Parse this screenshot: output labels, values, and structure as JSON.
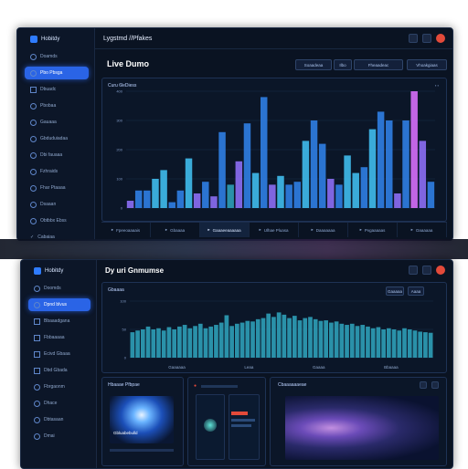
{
  "window1": {
    "app_name": "Hobitdy",
    "topbar_title": "Lygstmd //Pfakes",
    "page_title": "Live Dumo",
    "buttons": [
      "Soaadeaa",
      "Ilbo",
      "Fheaadeac",
      "Vhoakgiaas"
    ],
    "nav": [
      {
        "label": "Doamds",
        "icon": "dot"
      },
      {
        "label": "Pbo Pbsga",
        "icon": "dot"
      },
      {
        "label": "Dbuadc",
        "icon": "sq"
      },
      {
        "label": "Pbobaa",
        "icon": "dot"
      },
      {
        "label": "Gauaaa",
        "icon": "dot"
      },
      {
        "label": "Gbduduiadaa",
        "icon": "dot"
      },
      {
        "label": "Dbi fauaaa",
        "icon": "dot"
      },
      {
        "label": "Fzhraids",
        "icon": "dot"
      },
      {
        "label": "Fhar Ptaaaa",
        "icon": "dot"
      },
      {
        "label": "Dsaaan",
        "icon": "dot"
      },
      {
        "label": "Obtbbx Ebss",
        "icon": "dot"
      },
      {
        "label": "Cabaiaa",
        "icon": "check"
      }
    ],
    "active_nav": 1,
    "chart_panel_title": "Curu 6leDiess",
    "tabs": [
      "Fpeeoaaaais",
      "Gbaaaa",
      "Gaaaeeaaaaaa",
      "Ulhae Pluasa",
      "Daaaaaaa",
      "Pvgaaaaas",
      "Oaaaaaa"
    ],
    "active_tab": 2
  },
  "window2": {
    "app_name": "Hobitdy",
    "page_title": "Dy uri Gnmumse",
    "nav": [
      {
        "label": "Doomds",
        "icon": "dot"
      },
      {
        "label": "Dpnd blvus",
        "icon": "dot"
      },
      {
        "label": "Bbaaadgana",
        "icon": "sq"
      },
      {
        "label": "Fbbaaaaa",
        "icon": "sq"
      },
      {
        "label": "Ecivd Gbaaa",
        "icon": "sq"
      },
      {
        "label": "Dbd Gbada",
        "icon": "sq"
      },
      {
        "label": "Fbrgaonm",
        "icon": "dot"
      },
      {
        "label": "Dhace",
        "icon": "dot"
      },
      {
        "label": "Dbtasaan",
        "icon": "dot"
      },
      {
        "label": "Dmai",
        "icon": "dot"
      }
    ],
    "active_nav": 1,
    "chart_panel_title": "Gbaaaa",
    "chart_buttons": [
      "Gaaaaa",
      "Aaaa"
    ],
    "chart_footer": [
      "Gaaaaaa",
      "Leaa",
      "Gaaaa",
      "Bbaaaa"
    ],
    "card1_title": "Hbaaae Pfbpae",
    "card1_caption": "Gbluabebulld",
    "card3_title": "Cbaaaaaaeae"
  },
  "colors": {
    "accent": "#2a64e6",
    "bar_blue": "#2f7de0",
    "bar_cyan": "#3fb8e8",
    "bar_violet": "#8a6cf0",
    "bar_pink": "#d26cf5",
    "bar_teal": "#2e9cb4",
    "close": "#e34a3a"
  },
  "chart_data": [
    {
      "type": "bar",
      "title": "Curu 6leDiess",
      "y_ticks": [
        "400",
        "300",
        "200",
        "100",
        "0"
      ],
      "ylim": [
        0,
        400
      ],
      "values": [
        25,
        60,
        60,
        100,
        130,
        20,
        60,
        170,
        50,
        90,
        40,
        260,
        80,
        160,
        290,
        120,
        380,
        80,
        110,
        80,
        90,
        230,
        300,
        220,
        100,
        80,
        180,
        120,
        140,
        270,
        330,
        300,
        50,
        300,
        420,
        230,
        90
      ],
      "colors": [
        "violet",
        "blue",
        "blue",
        "cyan",
        "cyan",
        "blue",
        "blue",
        "cyan",
        "violet",
        "blue",
        "violet",
        "blue",
        "teal",
        "violet",
        "blue",
        "cyan",
        "blue",
        "violet",
        "cyan",
        "blue",
        "blue",
        "cyan",
        "blue",
        "blue",
        "violet",
        "blue",
        "cyan",
        "cyan",
        "blue",
        "cyan",
        "blue",
        "blue",
        "violet",
        "blue",
        "pink",
        "violet",
        "blue"
      ]
    },
    {
      "type": "bar",
      "title": "Gbaaaa",
      "y_ticks": [
        "100",
        "50",
        "0"
      ],
      "ylim": [
        0,
        100
      ],
      "values": [
        45,
        48,
        50,
        55,
        50,
        52,
        48,
        54,
        50,
        55,
        58,
        52,
        56,
        60,
        52,
        55,
        58,
        62,
        75,
        56,
        60,
        62,
        65,
        64,
        68,
        70,
        78,
        72,
        80,
        76,
        70,
        74,
        66,
        70,
        72,
        68,
        65,
        66,
        62,
        64,
        60,
        58,
        60,
        56,
        58,
        55,
        52,
        54,
        50,
        52,
        50,
        48,
        52,
        50,
        48,
        46,
        45,
        44
      ]
    }
  ]
}
